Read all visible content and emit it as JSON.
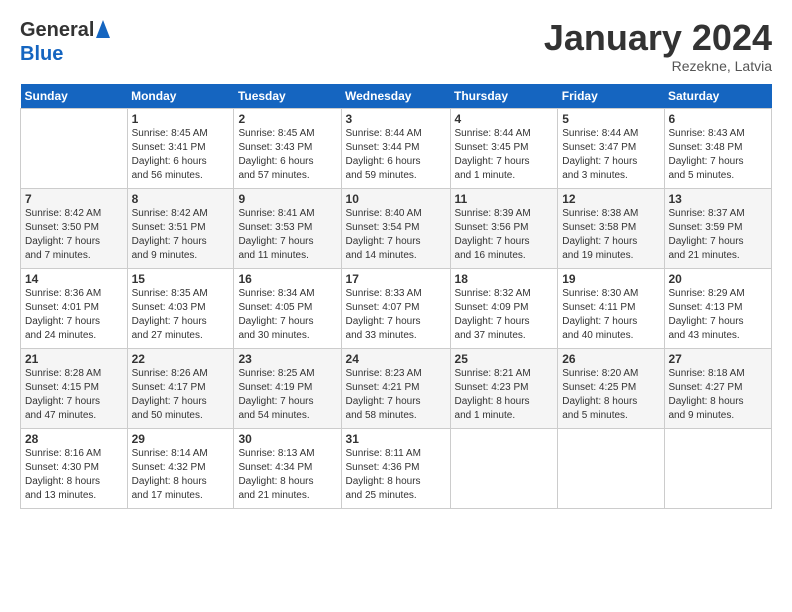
{
  "header": {
    "logo_general": "General",
    "logo_blue": "Blue",
    "month_title": "January 2024",
    "subtitle": "Rezekne, Latvia"
  },
  "weekdays": [
    "Sunday",
    "Monday",
    "Tuesday",
    "Wednesday",
    "Thursday",
    "Friday",
    "Saturday"
  ],
  "weeks": [
    [
      {
        "day": "",
        "info": ""
      },
      {
        "day": "1",
        "info": "Sunrise: 8:45 AM\nSunset: 3:41 PM\nDaylight: 6 hours\nand 56 minutes."
      },
      {
        "day": "2",
        "info": "Sunrise: 8:45 AM\nSunset: 3:43 PM\nDaylight: 6 hours\nand 57 minutes."
      },
      {
        "day": "3",
        "info": "Sunrise: 8:44 AM\nSunset: 3:44 PM\nDaylight: 6 hours\nand 59 minutes."
      },
      {
        "day": "4",
        "info": "Sunrise: 8:44 AM\nSunset: 3:45 PM\nDaylight: 7 hours\nand 1 minute."
      },
      {
        "day": "5",
        "info": "Sunrise: 8:44 AM\nSunset: 3:47 PM\nDaylight: 7 hours\nand 3 minutes."
      },
      {
        "day": "6",
        "info": "Sunrise: 8:43 AM\nSunset: 3:48 PM\nDaylight: 7 hours\nand 5 minutes."
      }
    ],
    [
      {
        "day": "7",
        "info": "Sunrise: 8:42 AM\nSunset: 3:50 PM\nDaylight: 7 hours\nand 7 minutes."
      },
      {
        "day": "8",
        "info": "Sunrise: 8:42 AM\nSunset: 3:51 PM\nDaylight: 7 hours\nand 9 minutes."
      },
      {
        "day": "9",
        "info": "Sunrise: 8:41 AM\nSunset: 3:53 PM\nDaylight: 7 hours\nand 11 minutes."
      },
      {
        "day": "10",
        "info": "Sunrise: 8:40 AM\nSunset: 3:54 PM\nDaylight: 7 hours\nand 14 minutes."
      },
      {
        "day": "11",
        "info": "Sunrise: 8:39 AM\nSunset: 3:56 PM\nDaylight: 7 hours\nand 16 minutes."
      },
      {
        "day": "12",
        "info": "Sunrise: 8:38 AM\nSunset: 3:58 PM\nDaylight: 7 hours\nand 19 minutes."
      },
      {
        "day": "13",
        "info": "Sunrise: 8:37 AM\nSunset: 3:59 PM\nDaylight: 7 hours\nand 21 minutes."
      }
    ],
    [
      {
        "day": "14",
        "info": "Sunrise: 8:36 AM\nSunset: 4:01 PM\nDaylight: 7 hours\nand 24 minutes."
      },
      {
        "day": "15",
        "info": "Sunrise: 8:35 AM\nSunset: 4:03 PM\nDaylight: 7 hours\nand 27 minutes."
      },
      {
        "day": "16",
        "info": "Sunrise: 8:34 AM\nSunset: 4:05 PM\nDaylight: 7 hours\nand 30 minutes."
      },
      {
        "day": "17",
        "info": "Sunrise: 8:33 AM\nSunset: 4:07 PM\nDaylight: 7 hours\nand 33 minutes."
      },
      {
        "day": "18",
        "info": "Sunrise: 8:32 AM\nSunset: 4:09 PM\nDaylight: 7 hours\nand 37 minutes."
      },
      {
        "day": "19",
        "info": "Sunrise: 8:30 AM\nSunset: 4:11 PM\nDaylight: 7 hours\nand 40 minutes."
      },
      {
        "day": "20",
        "info": "Sunrise: 8:29 AM\nSunset: 4:13 PM\nDaylight: 7 hours\nand 43 minutes."
      }
    ],
    [
      {
        "day": "21",
        "info": "Sunrise: 8:28 AM\nSunset: 4:15 PM\nDaylight: 7 hours\nand 47 minutes."
      },
      {
        "day": "22",
        "info": "Sunrise: 8:26 AM\nSunset: 4:17 PM\nDaylight: 7 hours\nand 50 minutes."
      },
      {
        "day": "23",
        "info": "Sunrise: 8:25 AM\nSunset: 4:19 PM\nDaylight: 7 hours\nand 54 minutes."
      },
      {
        "day": "24",
        "info": "Sunrise: 8:23 AM\nSunset: 4:21 PM\nDaylight: 7 hours\nand 58 minutes."
      },
      {
        "day": "25",
        "info": "Sunrise: 8:21 AM\nSunset: 4:23 PM\nDaylight: 8 hours\nand 1 minute."
      },
      {
        "day": "26",
        "info": "Sunrise: 8:20 AM\nSunset: 4:25 PM\nDaylight: 8 hours\nand 5 minutes."
      },
      {
        "day": "27",
        "info": "Sunrise: 8:18 AM\nSunset: 4:27 PM\nDaylight: 8 hours\nand 9 minutes."
      }
    ],
    [
      {
        "day": "28",
        "info": "Sunrise: 8:16 AM\nSunset: 4:30 PM\nDaylight: 8 hours\nand 13 minutes."
      },
      {
        "day": "29",
        "info": "Sunrise: 8:14 AM\nSunset: 4:32 PM\nDaylight: 8 hours\nand 17 minutes."
      },
      {
        "day": "30",
        "info": "Sunrise: 8:13 AM\nSunset: 4:34 PM\nDaylight: 8 hours\nand 21 minutes."
      },
      {
        "day": "31",
        "info": "Sunrise: 8:11 AM\nSunset: 4:36 PM\nDaylight: 8 hours\nand 25 minutes."
      },
      {
        "day": "",
        "info": ""
      },
      {
        "day": "",
        "info": ""
      },
      {
        "day": "",
        "info": ""
      }
    ]
  ]
}
